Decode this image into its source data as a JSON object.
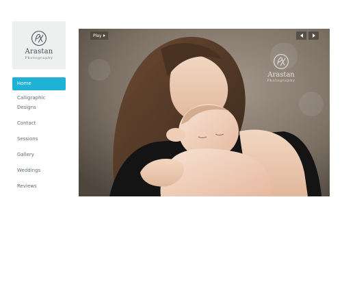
{
  "brand": {
    "name": "Arastan",
    "subtitle": "Photography",
    "accent_color": "#1fb1d6"
  },
  "nav": {
    "items": [
      {
        "label": "Home",
        "active": true
      },
      {
        "label": "Calligraphic",
        "active": false
      },
      {
        "label": "Designs",
        "active": false
      },
      {
        "label": "Contact",
        "active": false
      },
      {
        "label": "Sessions",
        "active": false
      },
      {
        "label": "Gallery",
        "active": false
      },
      {
        "label": "Weddings",
        "active": false
      },
      {
        "label": "Reviews",
        "active": false
      }
    ]
  },
  "slideshow": {
    "play_label": "Play",
    "prev_icon": "chevron-left-icon",
    "next_icon": "chevron-right-icon",
    "watermark_name": "Arastan",
    "watermark_subtitle": "Photography"
  }
}
